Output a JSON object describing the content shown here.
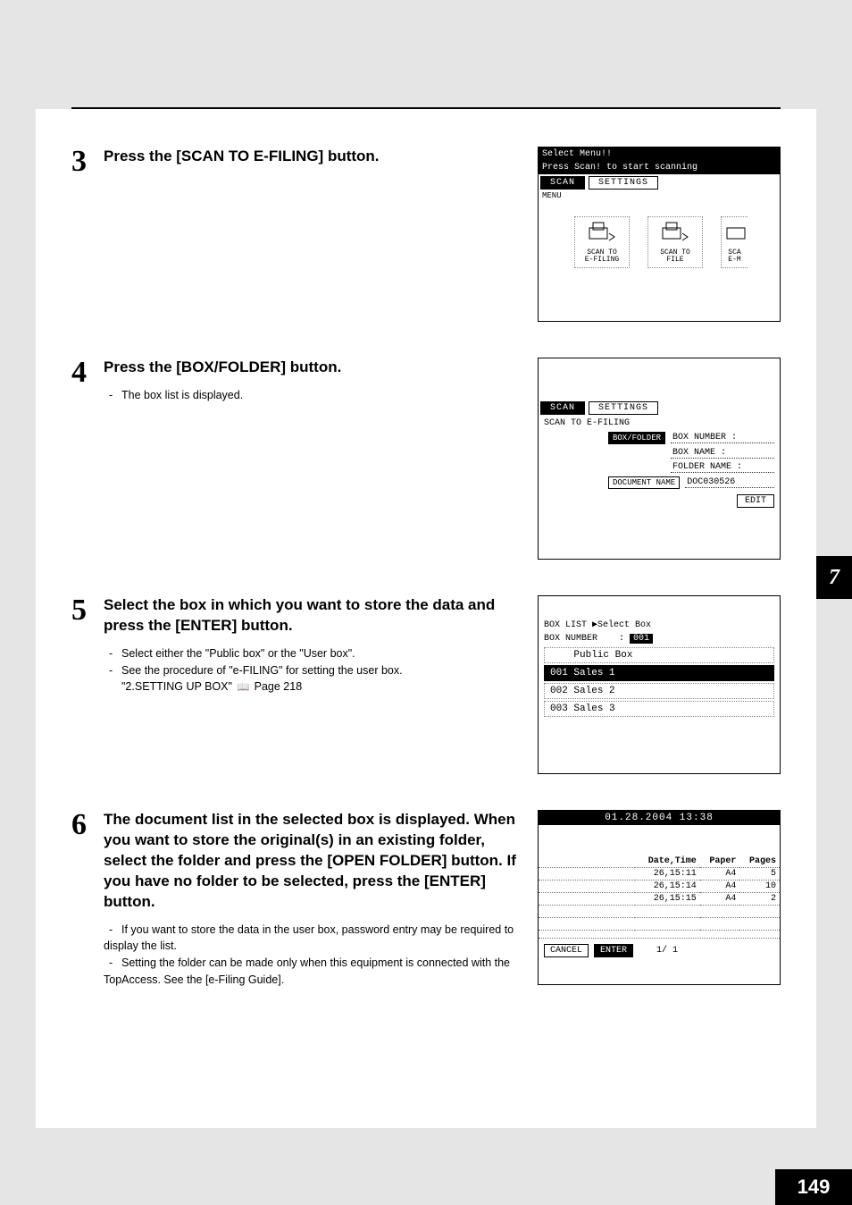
{
  "side_tab": "7",
  "page_number": "149",
  "steps": {
    "s3": {
      "num": "3",
      "title": "Press the [SCAN TO E-FILING] button.",
      "screen": {
        "line1": "Select Menu!!",
        "line2": "Press Scan! to start scanning",
        "tab_scan": "SCAN",
        "tab_settings": "SETTINGS",
        "menu_label": "MENU",
        "icon1": "SCAN TO\nE-FILING",
        "icon2": "SCAN TO\nFILE",
        "icon3": "SCA\nE-M"
      }
    },
    "s4": {
      "num": "4",
      "title": "Press the [BOX/FOLDER] button.",
      "note1": "The box list is displayed.",
      "screen": {
        "tab_scan": "SCAN",
        "tab_settings": "SETTINGS",
        "subtitle": "SCAN TO E-FILING",
        "btn_boxfolder": "BOX/FOLDER",
        "lbl_boxnum": "BOX NUMBER",
        "lbl_boxname": "BOX NAME",
        "lbl_foldername": "FOLDER NAME",
        "btn_docname": "DOCUMENT NAME",
        "docname_val": "DOC030526",
        "btn_edit": "EDIT"
      }
    },
    "s5": {
      "num": "5",
      "title": "Select the box in which you want to store the data and press the [ENTER] button.",
      "note1": "Select either the \"Public box\" or the \"User box\".",
      "note2": "See the procedure of \"e-FILING\" for setting the user box.",
      "note3": "\"2.SETTING UP BOX\"",
      "note3_page": "Page 218",
      "screen": {
        "hdr": "BOX LIST  ▶Select Box",
        "boxnum_label": "BOX NUMBER",
        "boxnum_val": "001",
        "row_public": "Public Box",
        "row1_num": "001",
        "row1_name": "Sales 1",
        "row2_num": "002",
        "row2_name": "Sales 2",
        "row3_num": "003",
        "row3_name": "Sales 3"
      }
    },
    "s6": {
      "num": "6",
      "title": "The document list in the selected box is displayed. When you want to store the original(s) in an existing folder, select the folder and press the [OPEN FOLDER] button. If you have no folder to be selected, press the [ENTER] button.",
      "note1": "If you want to store the data in the user box, password entry may be required to display the list.",
      "note2": "Setting the folder can be made only when this equipment is connected with the TopAccess. See the [e-Filing Guide].",
      "screen": {
        "datetime": "01.28.2004 13:38",
        "col_date": "Date,Time",
        "col_paper": "Paper",
        "col_pages": "Pages",
        "rows": [
          {
            "date": "26,15:11",
            "paper": "A4",
            "pages": "5"
          },
          {
            "date": "26,15:14",
            "paper": "A4",
            "pages": "10"
          },
          {
            "date": "26,15:15",
            "paper": "A4",
            "pages": "2"
          }
        ],
        "btn_cancel": "CANCEL",
        "btn_enter": "ENTER",
        "page_ind": "1/  1"
      }
    }
  }
}
